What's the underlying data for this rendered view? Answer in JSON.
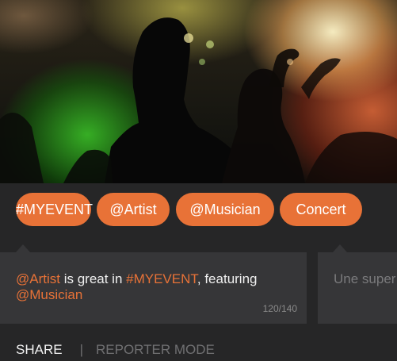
{
  "tags": [
    {
      "label": "#MYEVENT"
    },
    {
      "label": "@Artist"
    },
    {
      "label": "@Musician"
    },
    {
      "label": "Concert"
    }
  ],
  "post": {
    "mention": "@Artist",
    "text_1": " is great in ",
    "hashtag": "#MYEVENT",
    "text_2": ", featuring ",
    "mention_2": "@Musician",
    "counter": "120/140"
  },
  "post2": {
    "preview": "Une super"
  },
  "bottom_tabs": {
    "share": "SHARE",
    "separator": "|",
    "reporter": "REPORTER MODE"
  },
  "colors": {
    "accent": "#e87237",
    "card": "#363638",
    "background": "#262627"
  }
}
